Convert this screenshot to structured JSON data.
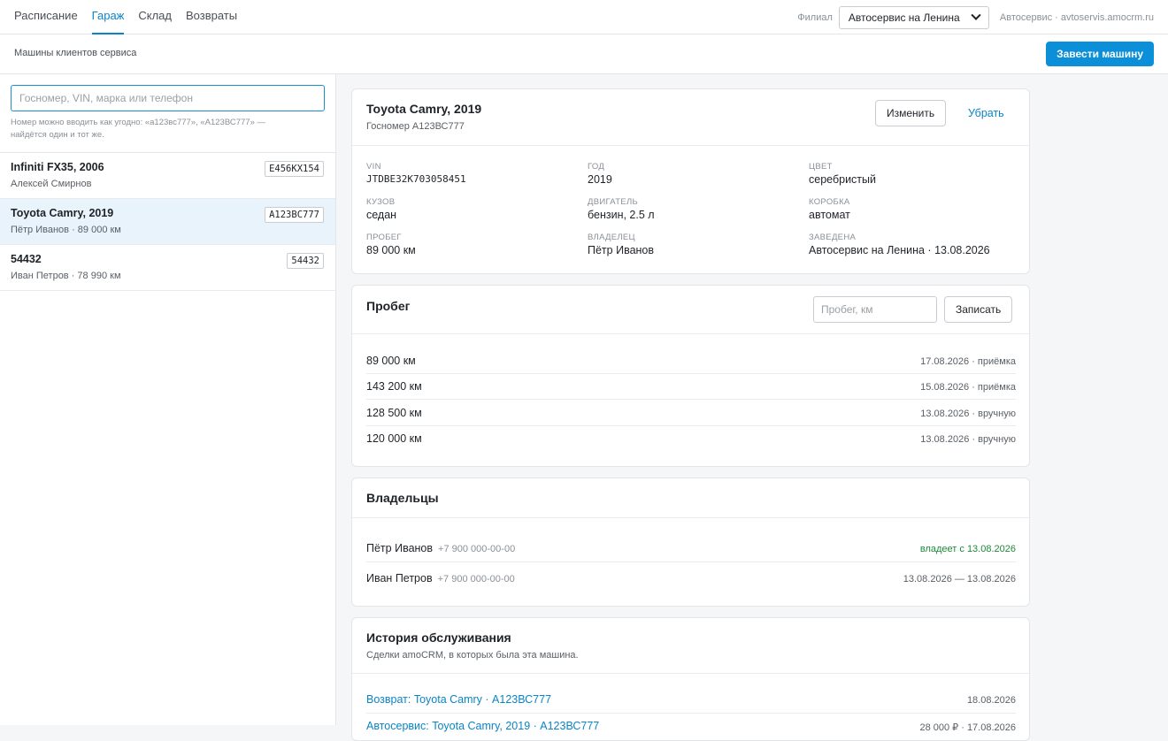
{
  "nav": {
    "items": [
      "Расписание",
      "Гараж",
      "Склад",
      "Возвраты"
    ],
    "active_index": 1
  },
  "branch": {
    "label": "Филиал",
    "selected": "Автосервис на Ленина",
    "account": "Автосервис · avtoservis.amocrm.ru"
  },
  "subheader": {
    "title": "Машины клиентов сервиса",
    "add_button": "Завести машину"
  },
  "search": {
    "placeholder": "Госномер, VIN, марка или телефон",
    "value": "",
    "hint": "Номер можно вводить как угодно: «а123вс777», «А123ВС777» — найдётся один и тот же."
  },
  "cars": [
    {
      "title": "Infiniti FX35, 2006",
      "sub": "Алексей Смирнов",
      "plate": "Е456КХ154",
      "selected": false
    },
    {
      "title": "Toyota Camry, 2019",
      "sub": "Пётр Иванов · 89 000 км",
      "plate": "А123ВС777",
      "selected": true
    },
    {
      "title": "54432",
      "sub": "Иван Петров · 78 990 км",
      "plate": "54432",
      "selected": false
    }
  ],
  "detail": {
    "title": "Toyota Camry, 2019",
    "plate_line": "Госномер А123ВС777",
    "edit_button": "Изменить",
    "remove_button": "Убрать",
    "specs": [
      {
        "label": "VIN",
        "value": "JTDBE32K703058451",
        "mono": true
      },
      {
        "label": "Год",
        "value": "2019"
      },
      {
        "label": "Цвет",
        "value": "серебристый"
      },
      {
        "label": "Кузов",
        "value": "седан"
      },
      {
        "label": "Двигатель",
        "value": "бензин, 2.5 л"
      },
      {
        "label": "Коробка",
        "value": "автомат"
      },
      {
        "label": "Пробег",
        "value": "89 000 км"
      },
      {
        "label": "Владелец",
        "value": "Пётр Иванов"
      },
      {
        "label": "Заведена",
        "value": "Автосервис на Ленина · 13.08.2026"
      }
    ]
  },
  "mileage": {
    "title": "Пробег",
    "input_placeholder": "Пробег, км",
    "save_button": "Записать",
    "rows": [
      {
        "km": "89 000 км",
        "meta": "17.08.2026 · приёмка"
      },
      {
        "km": "143 200 км",
        "meta": "15.08.2026 · приёмка"
      },
      {
        "km": "128 500 км",
        "meta": "13.08.2026 · вручную"
      },
      {
        "km": "120 000 км",
        "meta": "13.08.2026 · вручную"
      }
    ]
  },
  "owners": {
    "title": "Владельцы",
    "rows": [
      {
        "name": "Пётр Иванов",
        "phone": "+7 900 000-00-00",
        "period": "владеет с 13.08.2026",
        "current": true
      },
      {
        "name": "Иван Петров",
        "phone": "+7 900 000-00-00",
        "period": "13.08.2026 — 13.08.2026",
        "current": false
      }
    ]
  },
  "history": {
    "title": "История обслуживания",
    "subtitle": "Сделки amoCRM, в которых была эта машина.",
    "rows": [
      {
        "deal": "Возврат: Toyota Camry · А123ВС777",
        "meta": "18.08.2026"
      },
      {
        "deal": "Автосервис: Toyota Camry, 2019 · А123ВС777",
        "meta": "28 000 ₽ · 17.08.2026"
      }
    ]
  },
  "colors": {
    "accent": "#0b84c6",
    "primary_button": "#0b8fd8",
    "selected_row": "#e8f3fb",
    "current_owner": "#1e8a3a"
  }
}
